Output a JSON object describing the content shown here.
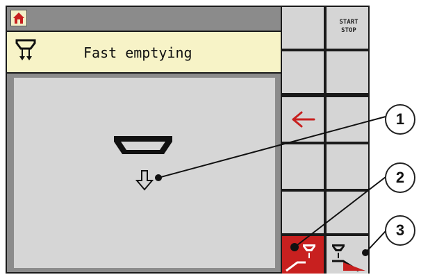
{
  "header": {
    "title": "Fast emptying"
  },
  "side_panel": {
    "start_stop_label_line1": "START",
    "start_stop_label_line2": "STOP"
  },
  "callouts": [
    "1",
    "2",
    "3"
  ],
  "icons": {
    "home": "home-icon",
    "header": "spreader-hopper-emptying-icon",
    "main": "hopper-icon",
    "down_arrow": "down-arrow-icon",
    "back": "back-arrow-icon",
    "left_slide": "left-slide-icon",
    "right_slide": "right-slide-icon"
  },
  "colors": {
    "accent_red": "#c8201f",
    "header_bg": "#f7f3c7",
    "cell_bg": "#d5d5d5"
  }
}
